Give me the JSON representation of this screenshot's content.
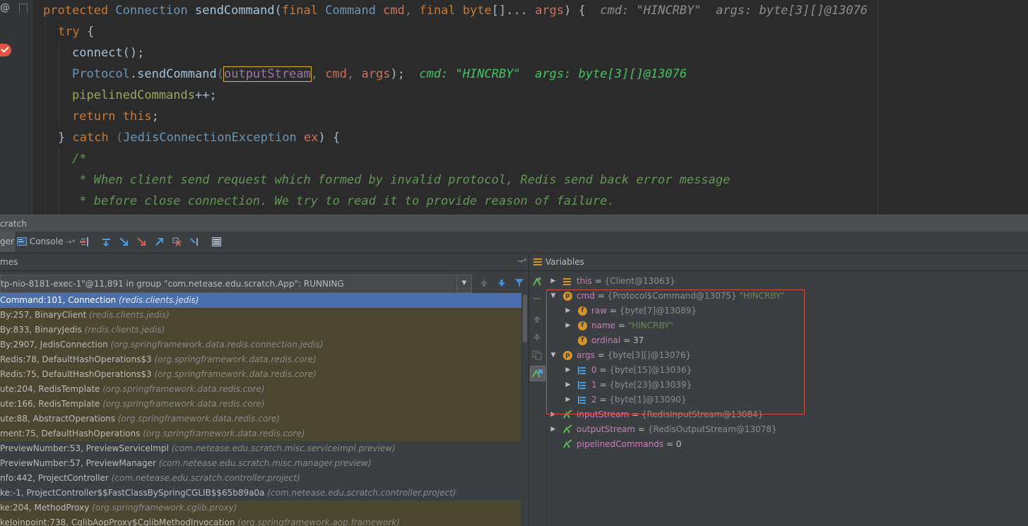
{
  "editor": {
    "gutter_at": "@",
    "lines": {
      "l1": {
        "kw1": "protected",
        "sp1": " ",
        "type1": "Connection",
        "sp2": " ",
        "fn": "sendCommand",
        "p1": "(",
        "kw2": "final",
        "sp3": " ",
        "type2": "Command",
        "sp4": " ",
        "param1": "cmd",
        "comma1": ", ",
        "kw3": "final",
        "sp5": " ",
        "kw4": "byte",
        "bracket": "[]... ",
        "param2": "args",
        "p2": ") {",
        "hint": "  cmd: \"HINCRBY\"  args: byte[3][]@13076"
      },
      "l2": {
        "kw": "try",
        "rest": " {"
      },
      "l3": {
        "fn": "connect",
        "rest": "();"
      },
      "l4": {
        "cls": "Protocol",
        "dot": ".",
        "fn": "sendCommand",
        "p1": "(",
        "arg1": "outputStream",
        "c1": ", ",
        "arg2": "cmd",
        "c2": ", ",
        "arg3": "args",
        "p2": ");",
        "hint": "  cmd: \"HINCRBY\"  args: byte[3][]@13076"
      },
      "l5": {
        "field": "pipelinedCommands",
        "rest": "++;"
      },
      "l6": {
        "kw": "return",
        "sp": " ",
        "kw2": "this",
        "rest": ";"
      },
      "l7": {
        "p1": "} ",
        "kw": "catch",
        "p2": " (",
        "type": "JedisConnectionException",
        "sp": " ",
        "param": "ex",
        "p3": ") {"
      },
      "l8": {
        "cmt": "/*"
      },
      "l9": {
        "cmt": " * When client send request which formed by invalid protocol, Redis send back error message"
      },
      "l10": {
        "cmt": " * before close connection. We try to read it to provide reason of failure."
      }
    }
  },
  "panel": {
    "title": "cratch",
    "tabs": {
      "debugger": "ger",
      "console": "Console",
      "console_pin": "→*"
    },
    "frames_label": "mes",
    "frames_pin": "→*",
    "thread_value": "tp-nio-8181-exec-1\"@11,891 in group \"com.netease.edu.scratch.App\": RUNNING",
    "frames": [
      {
        "m": "Command:101, Connection ",
        "p": "(redis.clients.jedis)",
        "state": "sel"
      },
      {
        "m": "By:257, BinaryClient ",
        "p": "(redis.clients.jedis)",
        "state": "lib"
      },
      {
        "m": "By:833, BinaryJedis ",
        "p": "(redis.clients.jedis)",
        "state": "lib"
      },
      {
        "m": "By:2907, JedisConnection ",
        "p": "(org.springframework.data.redis.connection.jedis)",
        "state": "lib"
      },
      {
        "m": "Redis:78, DefaultHashOperations$3 ",
        "p": "(org.springframework.data.redis.core)",
        "state": "lib"
      },
      {
        "m": "Redis:75, DefaultHashOperations$3 ",
        "p": "(org.springframework.data.redis.core)",
        "state": "lib"
      },
      {
        "m": "ute:204, RedisTemplate ",
        "p": "(org.springframework.data.redis.core)",
        "state": "lib"
      },
      {
        "m": "ute:166, RedisTemplate ",
        "p": "(org.springframework.data.redis.core)",
        "state": "lib"
      },
      {
        "m": "ute:88, AbstractOperations ",
        "p": "(org.springframework.data.redis.core)",
        "state": "lib"
      },
      {
        "m": "ment:75, DefaultHashOperations ",
        "p": "(org.springframework.data.redis.core)",
        "state": "lib"
      },
      {
        "m": "PreviewNumber:53, PreviewServiceImpl ",
        "p": "(com.netease.edu.scratch.misc.serviceimpl.preview)",
        "state": "app"
      },
      {
        "m": "PreviewNumber:57, PreviewManager ",
        "p": "(com.netease.edu.scratch.misc.manager.preview)",
        "state": "app"
      },
      {
        "m": "nfo:442, ProjectController ",
        "p": "(com.netease.edu.scratch.controller.project)",
        "state": "app"
      },
      {
        "m": "ke:-1, ProjectController$$FastClassBySpringCGLIB$$65b89a0a ",
        "p": "(com.netease.edu.scratch.controller.project)",
        "state": "app"
      },
      {
        "m": "ke:204, MethodProxy ",
        "p": "(org.springframework.cglib.proxy)",
        "state": "lib"
      },
      {
        "m": "keJoinpoint:738, CglibAopProxy$CglibMethodInvocation ",
        "p": "(org.springframework.aop.framework)",
        "state": "lib"
      }
    ],
    "variables_label": "Variables",
    "variables": [
      {
        "name": "this",
        "sep": " = ",
        "type": "{Client@13063}",
        "val": "",
        "level": 0,
        "expand": "▶",
        "icon": "lines"
      },
      {
        "name": "cmd",
        "sep": " = ",
        "type": "{Protocol$Command@13075} ",
        "val": "\"HINCRBY\"",
        "level": 0,
        "expand": "▼",
        "icon": "p"
      },
      {
        "name": "raw",
        "sep": " = ",
        "type": "{byte[7]@13089}",
        "val": "",
        "level": 1,
        "expand": "▶",
        "icon": "f"
      },
      {
        "name": "name",
        "sep": " = ",
        "type": "",
        "val": "\"HINCRBY\"",
        "level": 1,
        "expand": "▶",
        "icon": "f"
      },
      {
        "name": "ordinal",
        "sep": " = ",
        "type": "",
        "val": "37",
        "level": 1,
        "expand": "",
        "icon": "f"
      },
      {
        "name": "args",
        "sep": " = ",
        "type": "{byte[3][]@13076}",
        "val": "",
        "level": 0,
        "expand": "▼",
        "icon": "p"
      },
      {
        "name": "0",
        "sep": " = ",
        "type": "{byte[15]@13036}",
        "val": "",
        "level": 1,
        "expand": "▶",
        "icon": "arr"
      },
      {
        "name": "1",
        "sep": " = ",
        "type": "{byte[23]@13039}",
        "val": "",
        "level": 1,
        "expand": "▶",
        "icon": "arr"
      },
      {
        "name": "2",
        "sep": " = ",
        "type": "{byte[1]@13090}",
        "val": "",
        "level": 1,
        "expand": "▶",
        "icon": "arr"
      },
      {
        "name": "inputStream",
        "sep": " = ",
        "type": "{RedisInputStream@13084}",
        "val": "",
        "level": 0,
        "expand": "▶",
        "icon": "fld"
      },
      {
        "name": "outputStream",
        "sep": " = ",
        "type": "{RedisOutputStream@13078}",
        "val": "",
        "level": 0,
        "expand": "▶",
        "icon": "fld"
      },
      {
        "name": "pipelinedCommands",
        "sep": " = ",
        "type": "",
        "val": "0",
        "level": 0,
        "expand": "",
        "icon": "fld"
      }
    ]
  },
  "colors": {
    "selection": "#4b6eaf",
    "highlight_box": "#d24a3c",
    "hint_green": "#43c463"
  }
}
